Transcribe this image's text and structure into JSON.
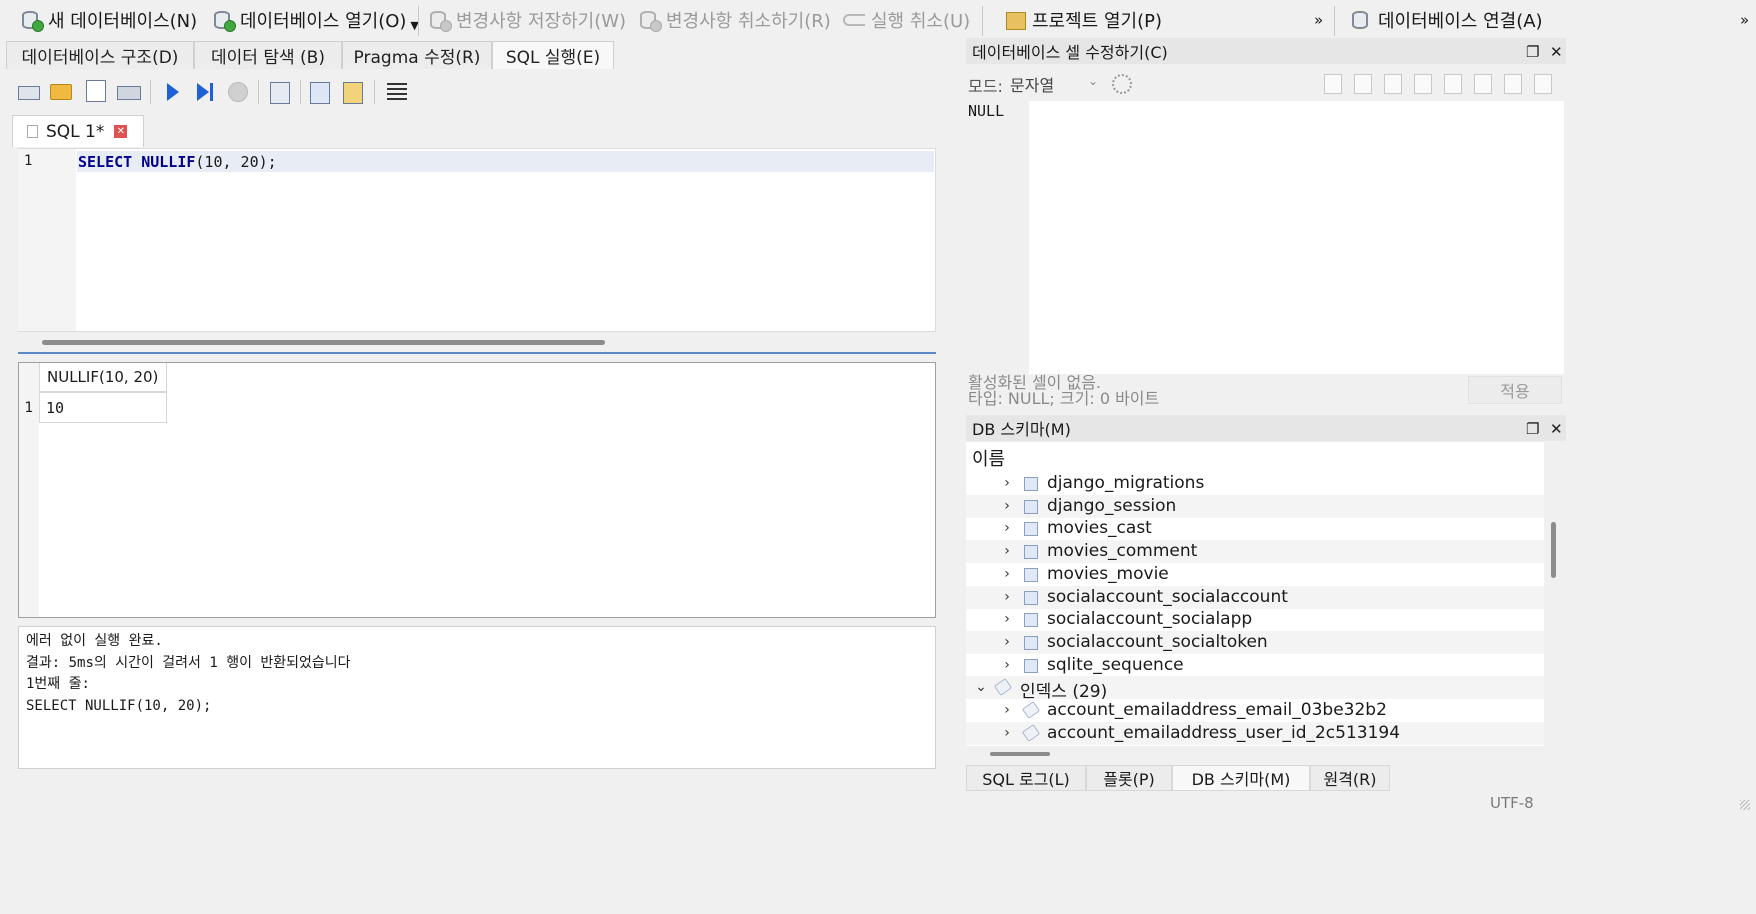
{
  "toolbar": {
    "new_db": "새 데이터베이스(N)",
    "open_db": "데이터베이스 열기(O)",
    "save_changes": "변경사항 저장하기(W)",
    "revert_changes": "변경사항 취소하기(R)",
    "undo": "실행 취소(U)",
    "open_project": "프로젝트 열기(P)",
    "overflow": "»",
    "attach_db": "데이터베이스 연결(A)",
    "overflow2": "»"
  },
  "tabs": {
    "structure": "데이터베이스 구조(D)",
    "browse": "데이터 탐색 (B)",
    "pragma": "Pragma 수정(R)",
    "execute": "SQL 실행(E)"
  },
  "editor": {
    "tab_label": "SQL 1*",
    "line_number": "1",
    "code_kw1": "SELECT",
    "code_kw2": "NULLIF",
    "code_rest": "(10, 20);"
  },
  "results": {
    "column_header": "NULLIF(10, 20)",
    "row_number": "1",
    "cell_value": "10"
  },
  "messages": {
    "text": "에러 없이 실행 완료.\n결과: 5ms의 시간이 걸려서 1 행이 반환되었습니다\n1번째 줄:\nSELECT NULLIF(10, 20);"
  },
  "cell_editor": {
    "title": "데이터베이스 셀 수정하기(C)",
    "mode_label": "모드:",
    "mode_value": "문자열",
    "content": "NULL",
    "status1": "활성화된 셀이 없음.",
    "status2": "타입: NULL; 크기: 0 바이트",
    "apply": "적용"
  },
  "schema": {
    "title": "DB 스키마(M)",
    "column_name": "이름",
    "tables": [
      "django_migrations",
      "django_session",
      "movies_cast",
      "movies_comment",
      "movies_movie",
      "socialaccount_socialaccount",
      "socialaccount_socialapp",
      "socialaccount_socialtoken",
      "sqlite_sequence"
    ],
    "indices_label": "인덱스 (29)",
    "indices": [
      "account_emailaddress_email_03be32b2",
      "account_emailaddress_user_id_2c513194"
    ]
  },
  "bottom_tabs": {
    "sql_log": "SQL 로그(L)",
    "plot": "플롯(P)",
    "db_schema": "DB 스키마(M)",
    "remote": "원격(R)"
  },
  "statusbar": {
    "encoding": "UTF-8"
  }
}
